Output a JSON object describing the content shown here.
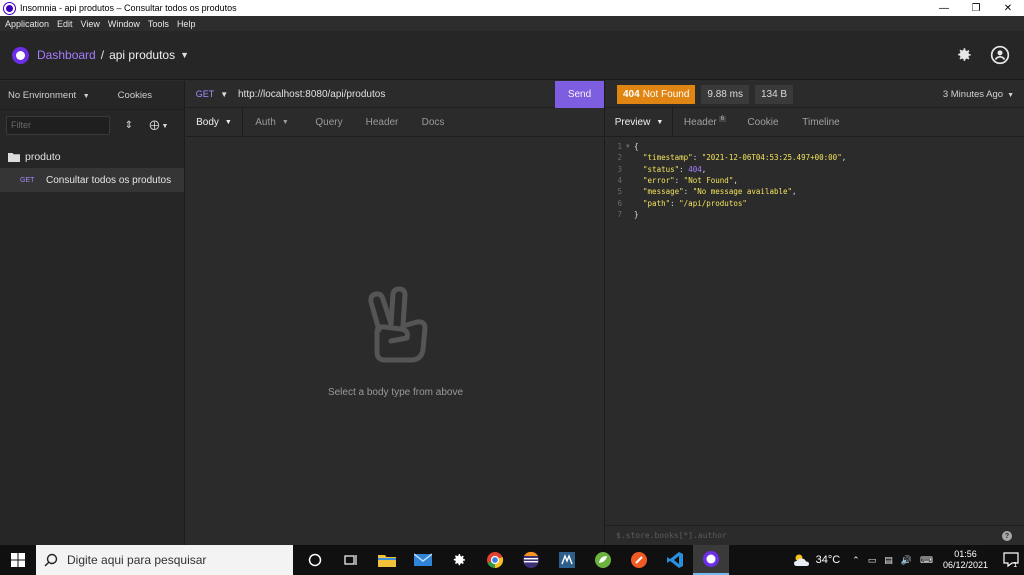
{
  "window": {
    "title": "Insomnia - api produtos – Consultar todos os produtos"
  },
  "menu": [
    "Application",
    "Edit",
    "View",
    "Window",
    "Tools",
    "Help"
  ],
  "header": {
    "dashboard": "Dashboard",
    "separator": "/",
    "workspace": "api produtos"
  },
  "sidebar": {
    "environment": "No Environment",
    "cookies": "Cookies",
    "filter_placeholder": "Filter",
    "folder": "produto",
    "request": {
      "method": "GET",
      "name": "Consultar todos os produtos"
    }
  },
  "request": {
    "method": "GET",
    "url": "http://localhost:8080/api/produtos",
    "send": "Send",
    "tabs": [
      "Body",
      "Auth",
      "Query",
      "Header",
      "Docs"
    ],
    "empty_text": "Select a body type from above"
  },
  "response": {
    "status_code": "404",
    "status_text": "Not Found",
    "time": "9.88 ms",
    "size": "134 B",
    "ago": "3 Minutes Ago",
    "tabs": [
      "Preview",
      "Header",
      "Cookie",
      "Timeline"
    ],
    "header_count": "6",
    "body": {
      "timestamp": "2021-12-06T04:53:25.497+00:00",
      "status": "404",
      "error": "Not Found",
      "message": "No message available",
      "path": "/api/produtos"
    },
    "filter_placeholder": "$.store.books[*].author"
  },
  "taskbar": {
    "search_placeholder": "Digite aqui para pesquisar",
    "temperature": "34°C",
    "time": "01:56",
    "date": "06/12/2021",
    "notification_count": "1"
  },
  "colors": {
    "accent": "#7e5ee0",
    "status_404": "#e08412",
    "json_string": "#f3e35c",
    "json_number": "#a982ff"
  }
}
